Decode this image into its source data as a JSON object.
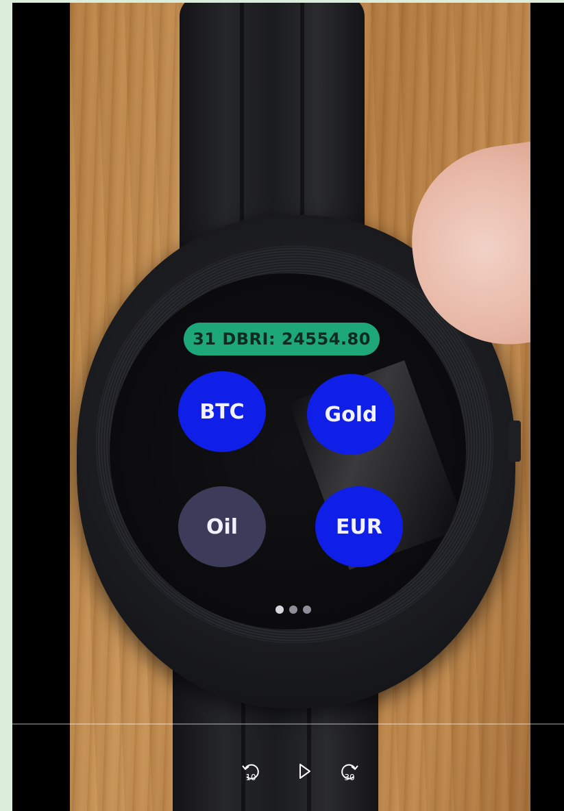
{
  "watch_app": {
    "index_label": "31 DBRI: 24554.80",
    "buttons": [
      {
        "label": "BTC",
        "state": "active"
      },
      {
        "label": "Gold",
        "state": "active"
      },
      {
        "label": "Oil",
        "state": "inactive"
      },
      {
        "label": "EUR",
        "state": "active"
      }
    ],
    "page_indicator": {
      "pages": 3,
      "current": 1
    }
  },
  "player": {
    "rewind_seconds": "10",
    "forward_seconds": "30",
    "icons": [
      "rewind-10-icon",
      "play-icon",
      "forward-30-icon"
    ],
    "progress_fraction": 0
  },
  "colors": {
    "badge": "#1ea87a",
    "active_button": "#0f1fe8",
    "inactive_button": "#3c3c5a",
    "background": "#dbeedb",
    "player_background": "#000000"
  }
}
